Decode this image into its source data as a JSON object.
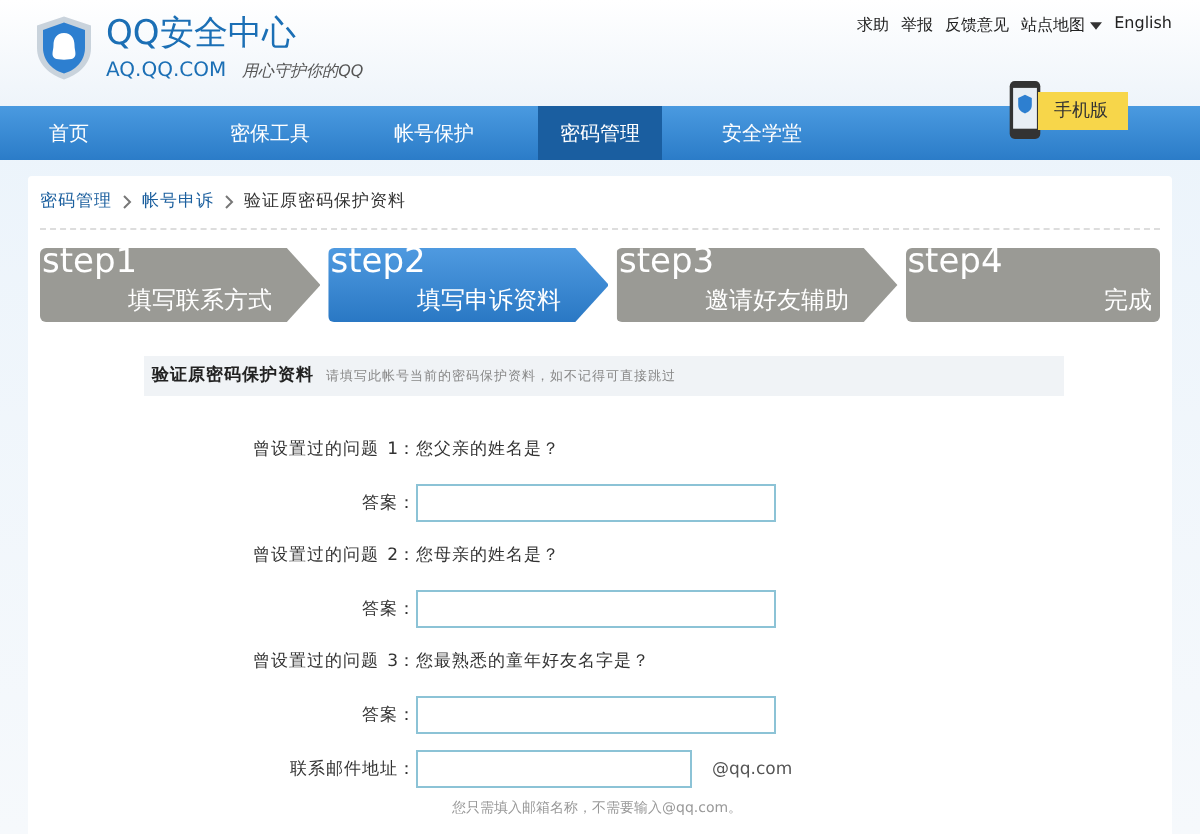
{
  "header": {
    "title": "QQ安全中心",
    "domain": "AQ.QQ.COM",
    "slogan": "用心守护你的QQ",
    "links": [
      {
        "label": "求助",
        "kind": "link"
      },
      {
        "label": "举报",
        "kind": "link"
      },
      {
        "label": "反馈意见",
        "kind": "link"
      },
      {
        "label": "站点地图",
        "kind": "dropdown"
      },
      {
        "label": "English",
        "kind": "link"
      }
    ],
    "mobile_badge": "手机版"
  },
  "nav": [
    {
      "label": "首页",
      "selected": false
    },
    {
      "label": "密保工具",
      "selected": false
    },
    {
      "label": "帐号保护",
      "selected": false
    },
    {
      "label": "密码管理",
      "selected": true
    },
    {
      "label": "安全学堂",
      "selected": false
    }
  ],
  "breadcrumb": [
    {
      "label": "密码管理",
      "kind": "link"
    },
    {
      "label": "帐号申诉",
      "kind": "link"
    },
    {
      "label": "验证原密码保护资料",
      "kind": "current"
    }
  ],
  "steps": [
    {
      "number": "step1",
      "label": "填写联系方式",
      "selected": false
    },
    {
      "number": "step2",
      "label": "填写申诉资料",
      "selected": true
    },
    {
      "number": "step3",
      "label": "邀请好友辅助",
      "selected": false
    },
    {
      "number": "step4",
      "label": "完成",
      "selected": false
    }
  ],
  "section": {
    "title": "验证原密码保护资料",
    "hint": "请填写此帐号当前的密码保护资料，如不记得可直接跳过"
  },
  "questions": [
    {
      "prefix": "曾设置过的问题",
      "index": "1：",
      "question": "您父亲的姓名是？",
      "answer_label": "答案："
    },
    {
      "prefix": "曾设置过的问题",
      "index": "2：",
      "question": "您母亲的姓名是？",
      "answer_label": "答案："
    },
    {
      "prefix": "曾设置过的问题",
      "index": "3：",
      "question": "您最熟悉的童年好友名字是？",
      "answer_label": "答案："
    }
  ],
  "email": {
    "label": "联系邮件地址：",
    "suffix": "@qq.com",
    "note": "您只需填入邮箱名称，不需要输入@qq.com。"
  }
}
